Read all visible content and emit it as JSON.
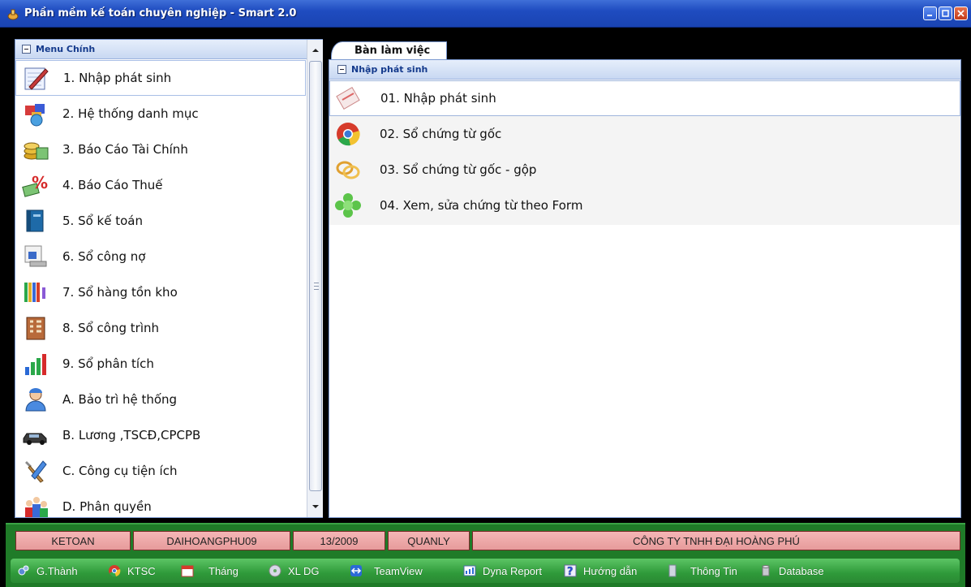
{
  "window": {
    "title": "Phần mềm kế toán chuyên nghiệp - Smart 2.0"
  },
  "left_panel": {
    "header": "Menu Chính",
    "items": [
      {
        "label": "1. Nhập phát sinh",
        "icon": "pen-notebook-icon"
      },
      {
        "label": "2. Hệ thống danh mục",
        "icon": "cubes-globe-icon"
      },
      {
        "label": "3. Báo Cáo Tài Chính",
        "icon": "coins-money-icon"
      },
      {
        "label": "4. Báo Cáo Thuế",
        "icon": "percent-money-icon"
      },
      {
        "label": "5. Sổ kế toán",
        "icon": "ledger-book-icon"
      },
      {
        "label": "6. Sổ công nợ",
        "icon": "document-card-icon"
      },
      {
        "label": "7. Sổ hàng tồn kho",
        "icon": "color-pencils-icon"
      },
      {
        "label": "8. Sổ công trình",
        "icon": "building-icon"
      },
      {
        "label": "9. Sổ phân tích",
        "icon": "bar-chart-icon"
      },
      {
        "label": "A. Bảo trì hệ thống",
        "icon": "technician-icon"
      },
      {
        "label": "B. Lương ,TSCĐ,CPCPB",
        "icon": "car-icon"
      },
      {
        "label": "C. Công cụ tiện ích",
        "icon": "tools-icon"
      },
      {
        "label": "D. Phân quyền",
        "icon": "users-group-icon"
      }
    ]
  },
  "right_panel": {
    "tab": "Bàn làm việc",
    "header": "Nhập phát sinh",
    "items": [
      {
        "label": "01. Nhập phát sinh",
        "icon": "notepad-icon"
      },
      {
        "label": "02. Sổ chứng từ gốc",
        "icon": "chrome-icon"
      },
      {
        "label": "03. Sổ chứng từ gốc - gộp",
        "icon": "rings-icon"
      },
      {
        "label": "04. Xem, sửa chứng từ  theo Form",
        "icon": "green-flower-icon"
      }
    ]
  },
  "status_bar": {
    "user": "KETOAN",
    "database": "DAIHOANGPHU09",
    "period": "13/2009",
    "role": "QUANLY",
    "company": "CÔNG TY TNHH ĐẠI HOÀNG PHÚ"
  },
  "toolbar": [
    {
      "label": "G.Thành",
      "icon": "gears-icon"
    },
    {
      "label": "KTSC",
      "icon": "chrome-icon"
    },
    {
      "label": "Tháng",
      "icon": "calendar-icon"
    },
    {
      "label": "XL DG",
      "icon": "disc-icon"
    },
    {
      "label": "TeamView",
      "icon": "teamviewer-icon"
    },
    {
      "label": "Dyna Report",
      "icon": "report-icon"
    },
    {
      "label": "Hướng dẫn",
      "icon": "help-icon"
    },
    {
      "label": "Thông Tin",
      "icon": "info-file-icon"
    },
    {
      "label": "Database",
      "icon": "database-icon"
    }
  ],
  "colors": {
    "title_bar": "#1f4cc0",
    "bottom_bar": "#1f7b28",
    "status_cell": "#f0aaaa",
    "panel_header": "#c8d8f2"
  }
}
